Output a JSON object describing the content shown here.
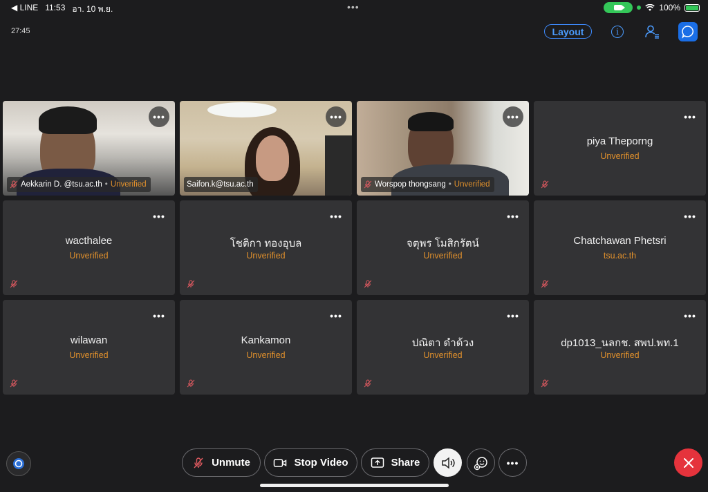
{
  "status_bar": {
    "back_app": "◀ LINE",
    "time": "11:53",
    "date": "อา. 10 พ.ย.",
    "battery": "100%",
    "multitask_dots": "•••"
  },
  "meeting": {
    "timer": "27:45",
    "layout_label": "Layout"
  },
  "colors": {
    "background": "#1c1c1e",
    "tile": "#333335",
    "unverified": "#e0902c",
    "accent": "#4b9cff",
    "end_call": "#e5333c",
    "muted_mic": "#e05a60"
  },
  "video_tiles": [
    {
      "name": "Aekkarin D. @tsu.ac.th",
      "status": "Unverified",
      "muted": true
    },
    {
      "name": "Saifon.k@tsu.ac.th",
      "status": "",
      "muted": false
    },
    {
      "name": "Worspop thongsang",
      "status": "Unverified",
      "muted": true
    }
  ],
  "participants": [
    {
      "name": "piya Theporng",
      "status": "Unverified"
    },
    {
      "name": "wacthalee",
      "status": "Unverified"
    },
    {
      "name": "โชติกา ทองอุบล",
      "status": "Unverified"
    },
    {
      "name": "จตุพร  โมสิกรัตน์",
      "status": "Unverified"
    },
    {
      "name": "Chatchawan Phetsri",
      "status": "tsu.ac.th"
    },
    {
      "name": "wilawan",
      "status": "Unverified"
    },
    {
      "name": "Kankamon",
      "status": "Unverified"
    },
    {
      "name": "ปณิตา ดำด้วง",
      "status": "Unverified"
    },
    {
      "name": "dp1013_นลกช. สพป.พท.1",
      "status": "Unverified"
    }
  ],
  "tile_menu": "•••",
  "toolbar": {
    "unmute": "Unmute",
    "stop_video": "Stop Video",
    "share": "Share",
    "more": "•••"
  }
}
